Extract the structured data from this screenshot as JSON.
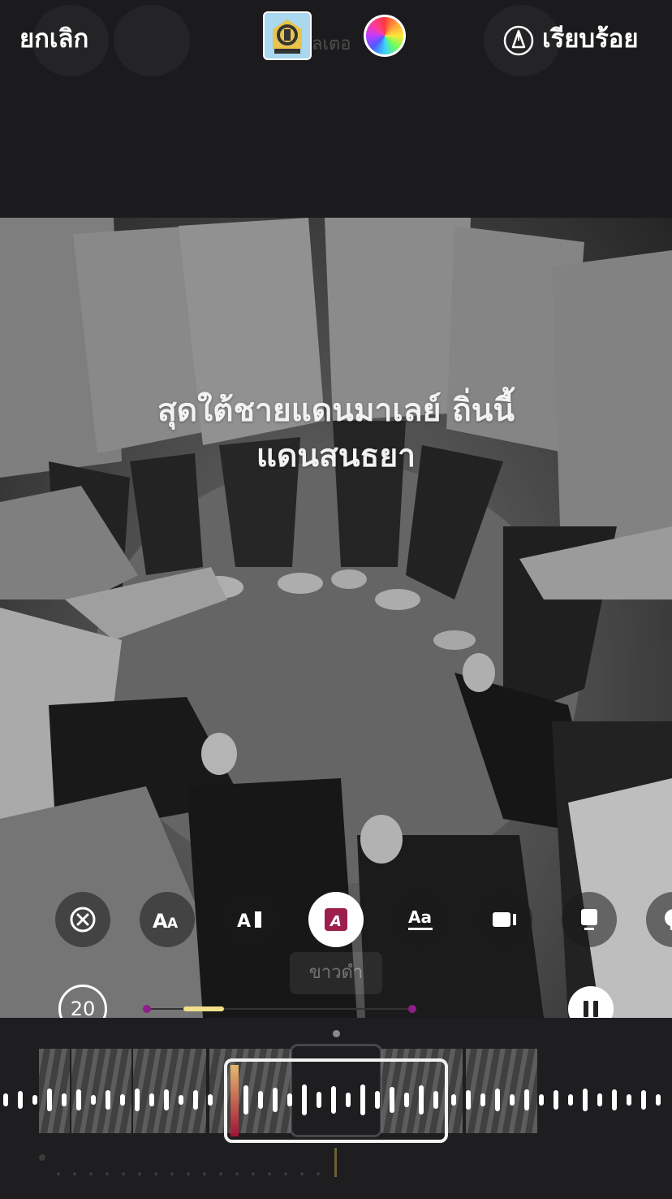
{
  "topbar": {
    "cancel_label": "ยกเลิก",
    "ghost_text": "ลเตอ",
    "done_label": "เรียบร้อย"
  },
  "caption": {
    "line1": "สุดใต้ชายแดนมาเลย์ ถิ่นนี้",
    "line2": "แดนสนธยา"
  },
  "toolbar": {
    "tools": [
      {
        "name": "clear-icon",
        "label": ""
      },
      {
        "name": "text-size-icon",
        "label": "AA"
      },
      {
        "name": "text-animation-icon",
        "label": "A I"
      },
      {
        "name": "text-style-icon",
        "label": "A"
      },
      {
        "name": "font-style-icon",
        "label": "Aa"
      },
      {
        "name": "camera-icon",
        "label": ""
      },
      {
        "name": "card-icon",
        "label": ""
      },
      {
        "name": "bubble-icon",
        "label": ""
      }
    ],
    "active_tool": "text-style-icon",
    "tooltip": "ขาวดำ"
  },
  "player": {
    "duration": "20",
    "state": "playing"
  },
  "colors": {
    "accent": "#9c1f4d",
    "scrub_purple": "#8e1e8a",
    "scrub_yellow": "#f2e08a",
    "background": "#1b1b1d"
  }
}
